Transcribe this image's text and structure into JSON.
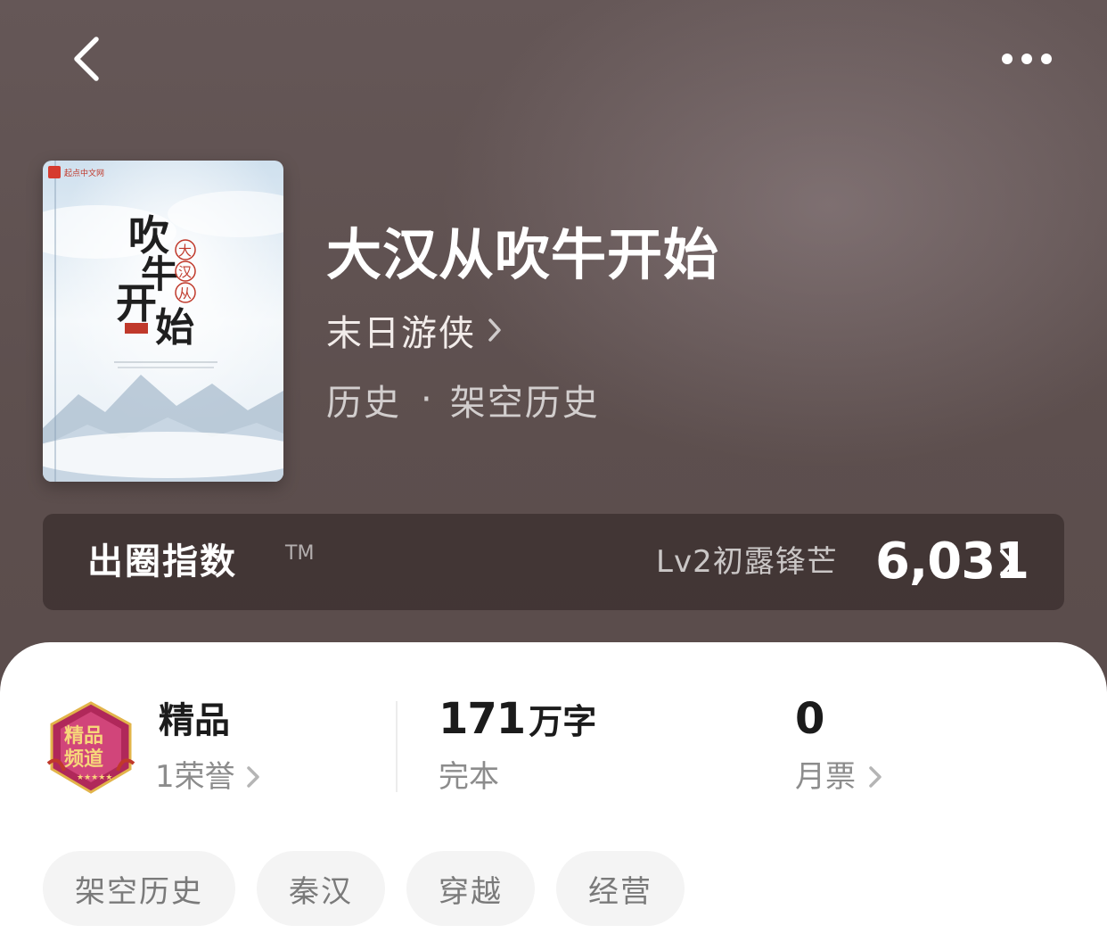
{
  "header": {
    "back_icon": "chevron-left-icon",
    "more_icon": "more-horizontal-icon"
  },
  "book": {
    "title": "大汉从吹牛开始",
    "author": "末日游侠",
    "category": "历史",
    "separator": "·",
    "subcategory": "架空历史",
    "cover": {
      "publisher_mark": "起点中文网",
      "title_main": "吹牛开始",
      "title_small": "大汉从",
      "colors": {
        "sky": "#e8f1f8",
        "cloud": "#c9d8e6",
        "mountain": "#9fb4c8",
        "seal": "#c0392b"
      }
    }
  },
  "index_bar": {
    "label": "出圈指数",
    "trademark": "TM",
    "level": "Lv2初露锋芒",
    "value": "6,031"
  },
  "stats": {
    "badge": {
      "icon": "premium-channel-badge-icon",
      "text": "精品频道",
      "colors": {
        "hex": "#b0285a",
        "gold": "#e2b44a"
      }
    },
    "quality": {
      "title": "精品",
      "sub": "1荣誉"
    },
    "words": {
      "number": "171",
      "unit": "万字",
      "status": "完本"
    },
    "votes": {
      "number": "0",
      "label": "月票"
    }
  },
  "tags": [
    "架空历史",
    "秦汉",
    "穿越",
    "经营"
  ],
  "colors": {
    "panel_bg": "#ffffff",
    "muted_text": "#8c8c8c",
    "tag_bg": "#f4f4f4"
  }
}
